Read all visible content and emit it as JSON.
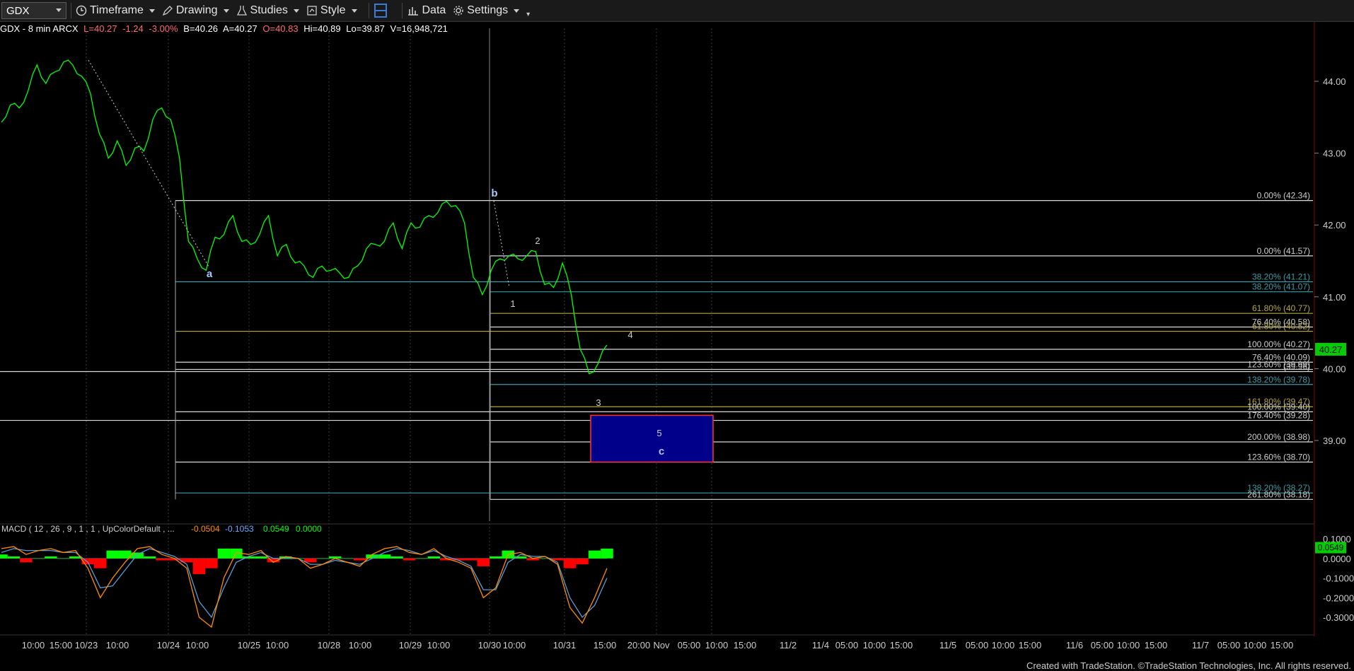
{
  "toolbar": {
    "symbol": "GDX",
    "items": [
      {
        "label": "Timeframe",
        "icon": "clock-icon"
      },
      {
        "label": "Drawing",
        "icon": "pen-icon"
      },
      {
        "label": "Studies",
        "icon": "flask-icon"
      },
      {
        "label": "Style",
        "icon": "style-icon"
      },
      {
        "label": "",
        "icon": "layout-icon"
      },
      {
        "label": "Data",
        "icon": "bar-chart-icon"
      },
      {
        "label": "Settings",
        "icon": "gear-icon"
      }
    ]
  },
  "info": {
    "title": "GDX - 8 min  ARCX",
    "last": "L=40.27",
    "change": "-1.24",
    "change_pct": "-3.00%",
    "bid": "B=40.26",
    "ask": "A=40.27",
    "open": "O=40.83",
    "high": "Hi=40.89",
    "low": "Lo=39.87",
    "volume": "V=16,948,721"
  },
  "colors": {
    "price": "#00ff00",
    "last_price_box": "#00cc00",
    "up_hist": "#00ff00",
    "down_hist": "#ff0000",
    "macd_line": "#ff8c00",
    "signal_line": "#5b9bd5",
    "fib_white": "#d8d8d8",
    "fib_teal": "#3e9aa6",
    "fib_olive": "#b5a642",
    "target_box_fill": "#00008b",
    "target_box_border": "#ff3333"
  },
  "chart_data": {
    "type": "line",
    "price_axis": {
      "min": 37.5,
      "max": 44.5,
      "ticks": [
        "44.00",
        "43.00",
        "42.00",
        "41.00",
        "40.00",
        "39.00"
      ]
    },
    "last_price": "40.27",
    "time_labels": [
      "10:00",
      "15:00",
      "10/23",
      "10:00",
      "10/24",
      "10:00",
      "10/25",
      "10:00",
      "10/28",
      "10:00",
      "10/29",
      "10:00",
      "10/30",
      "10:00",
      "10/31",
      "15:00",
      "20:00",
      "Nov",
      "05:00",
      "10:00",
      "15:00",
      "11/2",
      "11/4",
      "05:00",
      "10:00",
      "15:00",
      "11/5",
      "05:00",
      "10:00",
      "15:00",
      "11/6",
      "05:00",
      "10:00",
      "15:00",
      "11/7",
      "05:00",
      "10:00",
      "15:00"
    ],
    "wave_labels": [
      {
        "text": "a",
        "price": 41.3
      },
      {
        "text": "b",
        "price": 42.4
      },
      {
        "text": "1",
        "price": 40.9
      },
      {
        "text": "2",
        "price": 41.75
      },
      {
        "text": "3",
        "price": 39.5
      },
      {
        "text": "4",
        "price": 40.45
      },
      {
        "text": "5",
        "price": 39.1
      },
      {
        "text": "c",
        "price": 38.85
      }
    ],
    "fib_levels": [
      {
        "label": "0.00% (42.34)",
        "price": 42.34
      },
      {
        "label": "0.00% (41.57)",
        "price": 41.57
      },
      {
        "label": "38.20% (41.21)",
        "price": 41.21
      },
      {
        "label": "38.20% (41.07)",
        "price": 41.07
      },
      {
        "label": "61.80% (40.77)",
        "price": 40.77
      },
      {
        "label": "76.40% (40.58)",
        "price": 40.58
      },
      {
        "label": "61.80% (40.52)",
        "price": 40.52
      },
      {
        "label": "100.00% (40.27)",
        "price": 40.27
      },
      {
        "label": "76.40% (40.09)",
        "price": 40.09
      },
      {
        "label": "123.60% (39.99)",
        "price": 39.99
      },
      {
        "label": "(39.96)",
        "price": 39.96
      },
      {
        "label": "138.20% (39.78)",
        "price": 39.78
      },
      {
        "label": "161.80% (39.47)",
        "price": 39.47
      },
      {
        "label": "100.00% (39.40)",
        "price": 39.4
      },
      {
        "label": "176.40% (39.28)",
        "price": 39.28
      },
      {
        "label": "200.00% (38.98)",
        "price": 38.98
      },
      {
        "label": "123.60% (38.70)",
        "price": 38.7
      },
      {
        "label": "138.20% (38.27)",
        "price": 38.27
      },
      {
        "label": "261.80% (38.18)",
        "price": 38.18
      }
    ],
    "target_box": {
      "high": 39.35,
      "low": 38.7
    },
    "price_path": [
      [
        43.4,
        43.7,
        43.6,
        43.9,
        44.2,
        44.0,
        44.1,
        44.3,
        44.2,
        44.1,
        43.8,
        43.3,
        42.9,
        43.2,
        42.8,
        43.1,
        43.0,
        43.5,
        43.6,
        43.5,
        42.9,
        41.8,
        41.5,
        41.4,
        41.8,
        41.9,
        42.1,
        41.8,
        41.7,
        41.9,
        42.1,
        41.6,
        41.7,
        41.5,
        41.4,
        41.3,
        41.4,
        41.4,
        41.3,
        41.3,
        41.4,
        41.7,
        41.7,
        41.8,
        42.0,
        41.7,
        42.0,
        42.0,
        42.1,
        42.2,
        42.3,
        42.3,
        42.0,
        41.3,
        41.0,
        41.4,
        41.5,
        41.6,
        41.5,
        41.6,
        41.6,
        41.2,
        41.1,
        41.5,
        41.0,
        40.3,
        39.9,
        40.1,
        40.3
      ]
    ],
    "macd": {
      "label": "MACD ( 12 , 26 , 9 , 1 , 1 , UpColorDefault , ...",
      "macd": "-0.0504",
      "signal": "-0.1053",
      "hist": "0.0549",
      "zero": "0.0000",
      "axis_ticks": [
        "0.1000",
        "0.0000",
        "-0.1000",
        "-0.2000",
        "-0.3000"
      ],
      "axis_min": -0.36,
      "axis_max": 0.14,
      "last_hist": "0.0549",
      "macd_series": [
        0.05,
        0.06,
        0.02,
        0.04,
        0.05,
        0.03,
        0.04,
        -0.05,
        -0.2,
        -0.1,
        -0.02,
        0.05,
        0.06,
        0.02,
        0.0,
        -0.05,
        -0.3,
        -0.35,
        -0.1,
        0.03,
        0.02,
        0.04,
        -0.02,
        0.01,
        0.0,
        -0.05,
        -0.03,
        0.0,
        -0.02,
        -0.04,
        0.02,
        0.05,
        0.06,
        0.03,
        0.02,
        0.05,
        0.0,
        -0.02,
        -0.05,
        -0.2,
        -0.15,
        0.02,
        0.03,
        0.0,
        0.01,
        -0.03,
        -0.25,
        -0.33,
        -0.2,
        -0.05
      ],
      "signal_series": [
        0.03,
        0.05,
        0.04,
        0.04,
        0.04,
        0.03,
        0.03,
        -0.02,
        -0.15,
        -0.14,
        -0.06,
        0.02,
        0.05,
        0.03,
        0.01,
        -0.03,
        -0.22,
        -0.3,
        -0.15,
        -0.02,
        0.01,
        0.03,
        0.0,
        0.0,
        0.0,
        -0.03,
        -0.03,
        -0.01,
        -0.02,
        -0.03,
        0.0,
        0.03,
        0.05,
        0.04,
        0.02,
        0.04,
        0.01,
        -0.01,
        -0.04,
        -0.16,
        -0.16,
        -0.02,
        0.02,
        0.01,
        0.01,
        -0.02,
        -0.2,
        -0.3,
        -0.24,
        -0.1
      ]
    }
  },
  "footer": "Created with TradeStation. ©TradeStation Technologies, Inc. All rights reserved."
}
